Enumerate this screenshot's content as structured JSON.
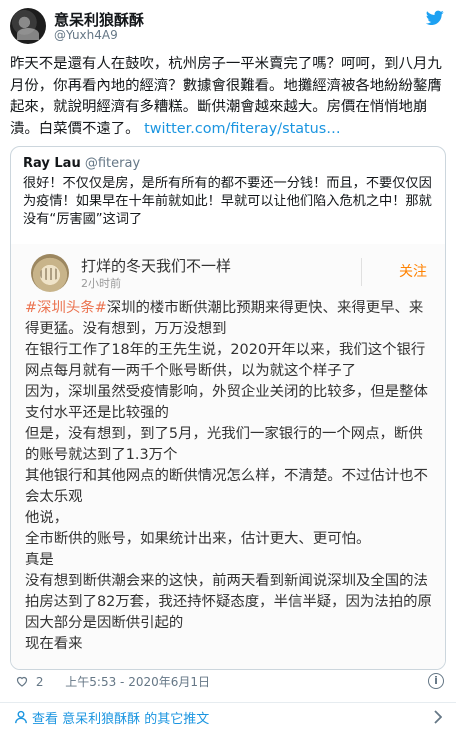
{
  "author": {
    "name": "意呆利狼酥酥",
    "handle": "@Yuxh4A9"
  },
  "tweet": {
    "text": "昨天不是還有人在鼓吹，杭州房子一平米賣完了嗎？呵呵，到八月九月份，你再看內地的經濟？數據會很難看。地攤經濟被各地紛紛鏊膺起來，就說明經濟有多糟糕。斷供潮會越來越大。房價在悄悄地崩潰。白菜價不遠了。",
    "link": "twitter.com/fiteray/status…"
  },
  "quoted": {
    "name": "Ray Lau",
    "handle": "@fiteray",
    "text": "很好！不仅仅是房，是所有所有的都不要还一分钱！而且，不要仅仅因为疫情！如果早在十年前就如此！早就可以让他们陷入危机之中！那就没有“厉害國”这词了"
  },
  "weibo": {
    "user": "打烊的冬天我们不一样",
    "time": "2小时前",
    "follow": "关注",
    "topic": "#深圳头条#",
    "lines": [
      "深圳的楼市断供潮比预期来得更快、来得更早、来得更猛。没有想到，万万没想到",
      "在银行工作了18年的王先生说，2020开年以来，我们这个银行网点每月就有一两千个账号断供，以为就这个样子了",
      "因为，深圳虽然受疫情影响，外贸企业关闭的比较多，但是整体支付水平还是比较强的",
      "但是，没有想到，到了5月，光我们一家银行的一个网点，断供的账号就达到了1.3万个",
      "其他银行和其他网点的断供情况怎么样，不清楚。不过估计也不会太乐观",
      "他说，",
      "全市断供的账号，如果统计出来，估计更大、更可怕。",
      "真是",
      "没有想到断供潮会来的这快，前两天看到新闻说深圳及全国的法拍房达到了82万套，我还持怀疑态度，半信半疑，因为法拍的原因大部分是因断供引起的",
      "现在看来"
    ]
  },
  "meta": {
    "likes": "2",
    "timestamp": "上午5:53 - 2020年6月1日",
    "info": "i"
  },
  "footer": {
    "label": "查看 意呆利狼酥酥 的其它推文"
  },
  "colors": {
    "link": "#1b95e0",
    "weibo_orange": "#ff8200",
    "topic": "#eb7350",
    "muted": "#657786",
    "border": "#ccd6dd"
  },
  "icons": [
    "twitter-bird-icon",
    "heart-icon",
    "info-icon",
    "person-icon",
    "chevron-right-icon"
  ]
}
